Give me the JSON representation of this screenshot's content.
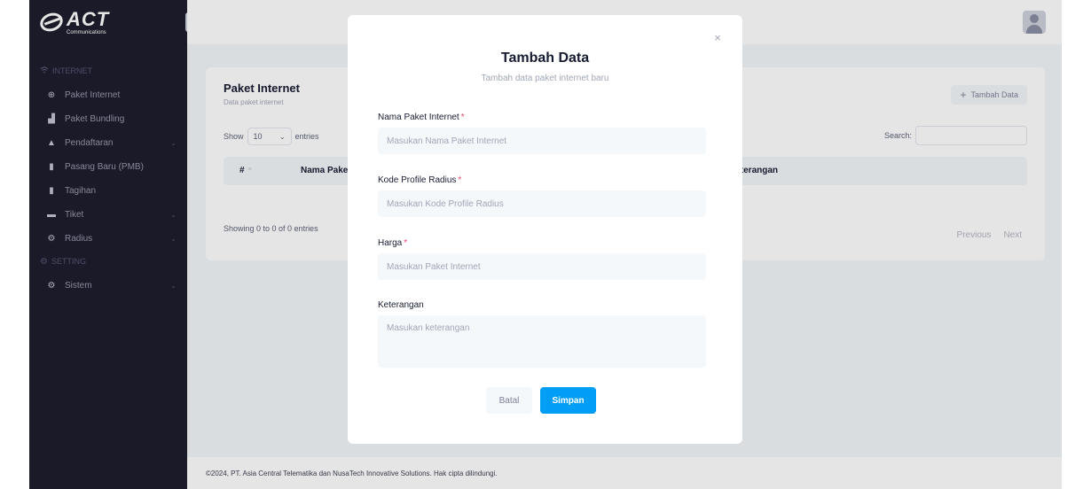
{
  "brand": {
    "name": "ACT",
    "subtitle": "Communications"
  },
  "sidebar": {
    "collapse_icon": "«",
    "sections": [
      {
        "title": "INTERNET",
        "icon": "wifi-icon",
        "items": [
          {
            "label": "Paket Internet",
            "icon": "globe-icon",
            "glyph": "⊕",
            "has_submenu": false
          },
          {
            "label": "Paket Bundling",
            "icon": "boxes-icon",
            "glyph": "▟",
            "has_submenu": false
          },
          {
            "label": "Pendaftaran",
            "icon": "user-icon",
            "glyph": "▲",
            "has_submenu": true
          },
          {
            "label": "Pasang Baru (PMB)",
            "icon": "file-icon",
            "glyph": "▮",
            "has_submenu": false
          },
          {
            "label": "Tagihan",
            "icon": "file-icon",
            "glyph": "▮",
            "has_submenu": false
          },
          {
            "label": "Tiket",
            "icon": "ticket-icon",
            "glyph": "▬",
            "has_submenu": true
          },
          {
            "label": "Radius",
            "icon": "cogs-icon",
            "glyph": "⚙",
            "has_submenu": true
          }
        ]
      },
      {
        "title": "SETTING",
        "icon": "gear-icon",
        "items": [
          {
            "label": "Sistem",
            "icon": "cogs-icon",
            "glyph": "⚙",
            "has_submenu": true
          }
        ]
      }
    ]
  },
  "page": {
    "title": "Paket Internet",
    "subtitle": "Data paket internet",
    "add_button": "Tambah Data",
    "show_label": "Show",
    "entries_value": "10",
    "entries_label": "entries",
    "search_label": "Search:",
    "columns": [
      "#",
      "Nama Paket",
      "Keterangan"
    ],
    "info": "Showing 0 to 0 of 0 entries",
    "pager": {
      "previous": "Previous",
      "next": "Next"
    }
  },
  "footer": {
    "text": "©2024, PT. Asia Central Telematika dan NusaTech Innovative Solutions. Hak cipta dilindungi."
  },
  "modal": {
    "title": "Tambah Data",
    "subtitle": "Tambah data paket internet baru",
    "fields": {
      "nama_paket": {
        "label": "Nama Paket Internet",
        "required": "*",
        "placeholder": "Masukan Nama Paket Internet"
      },
      "kode_profile": {
        "label": "Kode Profile Radius",
        "required": "*",
        "placeholder": "Masukan Kode Profile Radius"
      },
      "harga": {
        "label": "Harga",
        "required": "*",
        "placeholder": "Masukan Paket Internet"
      },
      "keterangan": {
        "label": "Keterangan",
        "placeholder": "Masukan keterangan"
      }
    },
    "cancel_label": "Batal",
    "save_label": "Simpan"
  },
  "colors": {
    "sidebar_bg": "#1e1e2d",
    "primary": "#009ef7",
    "required": "#f1416c"
  }
}
